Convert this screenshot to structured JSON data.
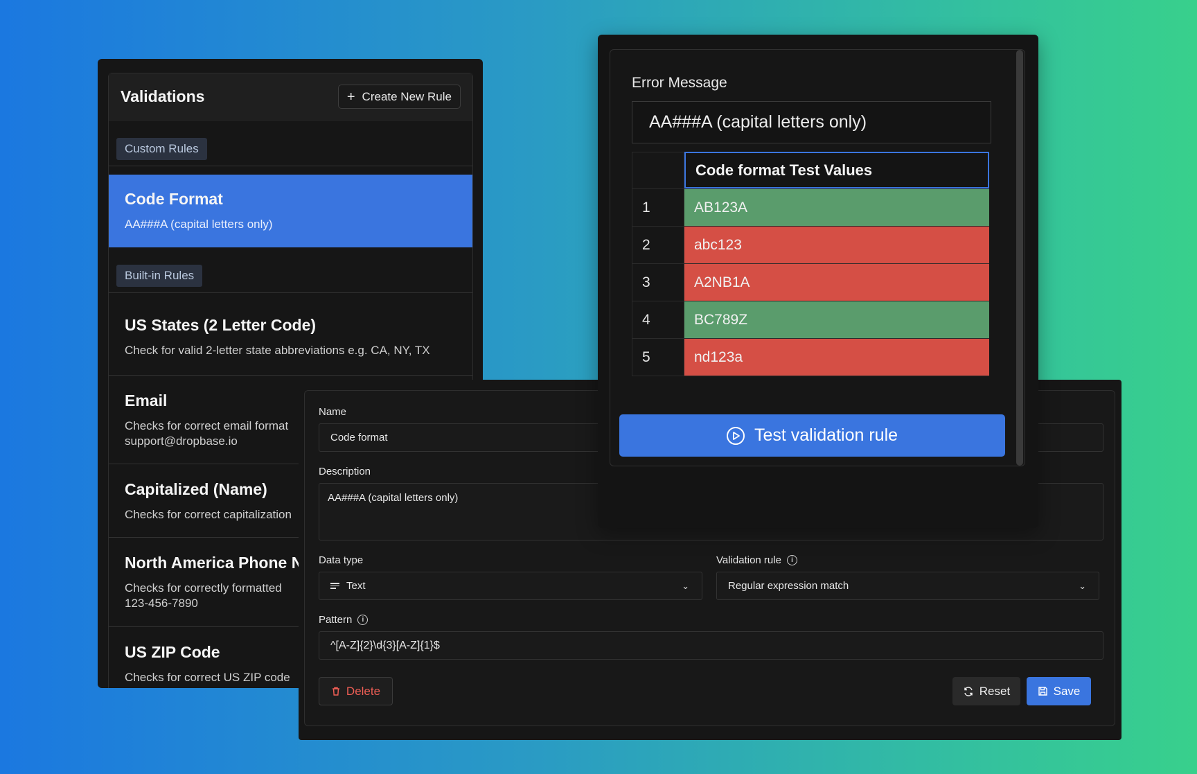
{
  "validations": {
    "title": "Validations",
    "create_button": "Create New Rule",
    "custom_section": "Custom Rules",
    "builtin_section": "Built-in Rules",
    "custom_rules": [
      {
        "name": "Code Format",
        "description": "AA###A (capital letters only)"
      }
    ],
    "builtin_rules": [
      {
        "name": "US States (2 Letter Code)",
        "description": "Check for valid 2-letter state abbreviations e.g. CA, NY, TX"
      },
      {
        "name": "Email",
        "description": "Checks for correct email format",
        "description2": "support@dropbase.io"
      },
      {
        "name": "Capitalized (Name)",
        "description": "Checks for correct capitalization"
      },
      {
        "name": "North America Phone Nu",
        "description": "Checks for correctly formatted",
        "description2": "123-456-7890"
      },
      {
        "name": "US ZIP Code",
        "description": "Checks for correct US ZIP code"
      }
    ]
  },
  "form": {
    "name_label": "Name",
    "name_value": "Code format",
    "description_label": "Description",
    "description_value": "AA###A (capital letters only)",
    "data_type_label": "Data type",
    "data_type_value": "Text",
    "validation_rule_label": "Validation rule",
    "validation_rule_value": "Regular expression match",
    "pattern_label": "Pattern",
    "pattern_value": "^[A-Z]{2}\\d{3}[A-Z]{1}$",
    "delete_label": "Delete",
    "reset_label": "Reset",
    "save_label": "Save"
  },
  "test_panel": {
    "error_label": "Error Message",
    "error_value": "AA###A (capital letters only)",
    "table_header": "Code format Test Values",
    "rows": [
      {
        "index": "1",
        "value": "AB123A",
        "status": "pass"
      },
      {
        "index": "2",
        "value": "abc123",
        "status": "fail"
      },
      {
        "index": "3",
        "value": "A2NB1A",
        "status": "fail"
      },
      {
        "index": "4",
        "value": "BC789Z",
        "status": "pass"
      },
      {
        "index": "5",
        "value": "nd123a",
        "status": "fail"
      }
    ],
    "test_button": "Test validation rule"
  },
  "colors": {
    "accent": "#3a75df",
    "pass": "#5a9c6c",
    "fail": "#d54f45",
    "danger_text": "#ef5e55"
  }
}
